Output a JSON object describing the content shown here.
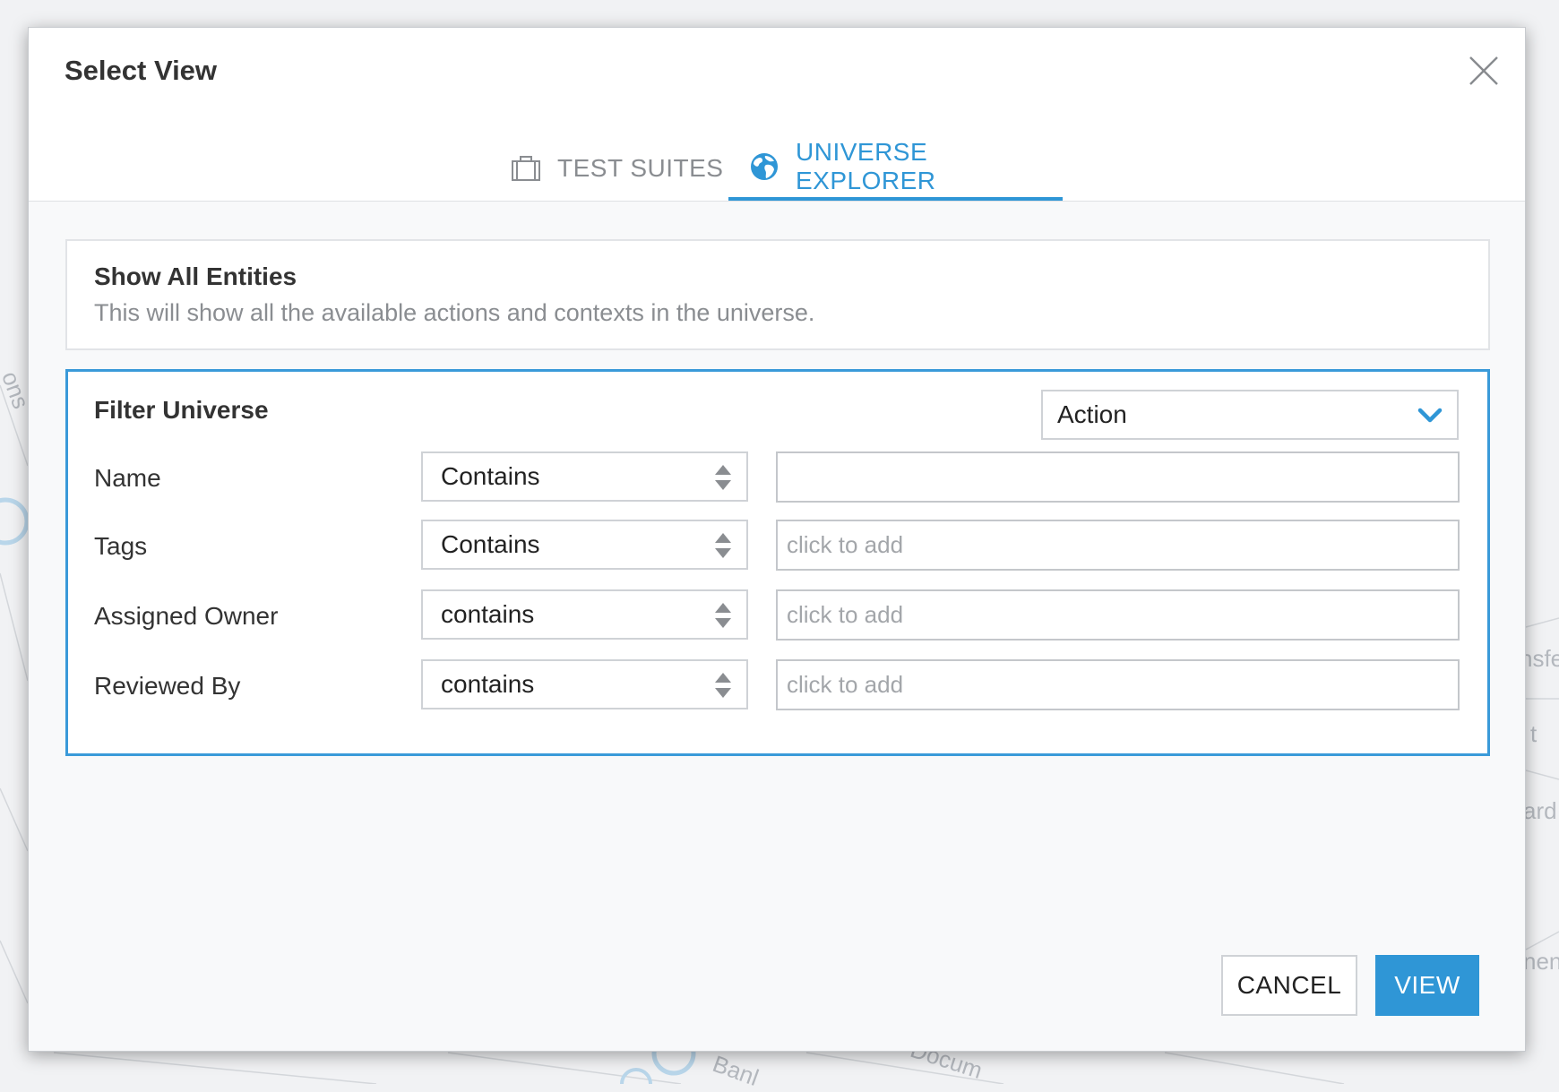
{
  "background": {
    "labels": [
      "ons",
      "nsfe",
      "t",
      "ard",
      "nen",
      "Banl",
      "Docum"
    ]
  },
  "modal": {
    "title": "Select View",
    "close_icon": "close-icon"
  },
  "tabs": [
    {
      "label": "TEST SUITES",
      "icon": "briefcase-icon",
      "active": false
    },
    {
      "label": "UNIVERSE EXPLORER",
      "icon": "globe-icon",
      "active": true
    }
  ],
  "show_all": {
    "title": "Show All Entities",
    "description": "This will show all the available actions and contexts in the universe."
  },
  "filter": {
    "title": "Filter Universe",
    "entity_type": "Action",
    "rows": [
      {
        "label": "Name",
        "operator": "Contains",
        "value": "",
        "placeholder": ""
      },
      {
        "label": "Tags",
        "operator": "Contains",
        "value": "",
        "placeholder": "click to add"
      },
      {
        "label": "Assigned Owner",
        "operator": "contains",
        "value": "",
        "placeholder": "click to add"
      },
      {
        "label": "Reviewed By",
        "operator": "contains",
        "value": "",
        "placeholder": "click to add"
      }
    ]
  },
  "buttons": {
    "cancel": "CANCEL",
    "view": "VIEW"
  },
  "colors": {
    "accent": "#2f96d6",
    "filter_border": "#3a9ad9"
  }
}
